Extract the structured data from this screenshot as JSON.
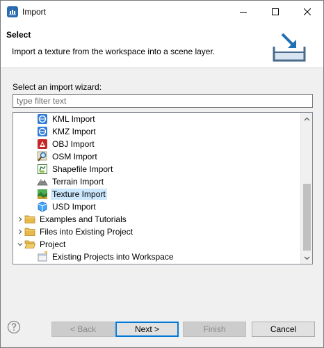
{
  "window": {
    "title": "Import"
  },
  "header": {
    "title": "Select",
    "description": "Import a texture from the workspace into a scene layer."
  },
  "wizard": {
    "label": "Select an import wizard:",
    "filter_placeholder": "type filter text",
    "filter_value": ""
  },
  "tree": {
    "items": [
      {
        "label": "KML Import",
        "icon": "kml-globe-icon",
        "level": 2
      },
      {
        "label": "KMZ Import",
        "icon": "kmz-globe-icon",
        "level": 2
      },
      {
        "label": "OBJ Import",
        "icon": "obj-icon",
        "level": 2
      },
      {
        "label": "OSM Import",
        "icon": "osm-magnifier-icon",
        "level": 2
      },
      {
        "label": "Shapefile Import",
        "icon": "shapefile-icon",
        "level": 2
      },
      {
        "label": "Terrain Import",
        "icon": "terrain-icon",
        "level": 2
      },
      {
        "label": "Texture Import",
        "icon": "texture-icon",
        "level": 2,
        "selected": true
      },
      {
        "label": "USD Import",
        "icon": "usd-cube-icon",
        "level": 2
      },
      {
        "label": "Examples and Tutorials",
        "icon": "folder-icon",
        "level": 1,
        "expander": "collapsed"
      },
      {
        "label": "Files into Existing Project",
        "icon": "folder-icon",
        "level": 1,
        "expander": "collapsed"
      },
      {
        "label": "Project",
        "icon": "folder-open-icon",
        "level": 1,
        "expander": "expanded"
      },
      {
        "label": "Existing Projects into Workspace",
        "icon": "project-import-icon",
        "level": 2
      }
    ]
  },
  "buttons": {
    "back": "< Back",
    "next": "Next >",
    "finish": "Finish",
    "cancel": "Cancel"
  },
  "colors": {
    "selection": "#cce8ff",
    "default_button_border": "#0078d7",
    "dialog_background": "#f0f0f0"
  }
}
